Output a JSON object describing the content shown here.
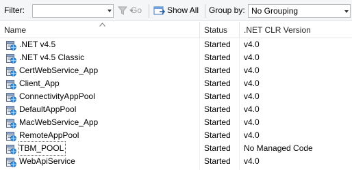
{
  "toolbar": {
    "filter_label": "Filter:",
    "filter_value": "",
    "go_label": "Go",
    "show_all_label": "Show All",
    "group_by_label": "Group by:",
    "group_by_value": "No Grouping"
  },
  "table": {
    "columns": [
      "Name",
      "Status",
      ".NET CLR Version"
    ],
    "rows": [
      {
        "name": ".NET v4.5",
        "status": "Started",
        "clr": "v4.0"
      },
      {
        "name": ".NET v4.5 Classic",
        "status": "Started",
        "clr": "v4.0"
      },
      {
        "name": "CertWebService_App",
        "status": "Started",
        "clr": "v4.0"
      },
      {
        "name": "Client_App",
        "status": "Started",
        "clr": "v4.0"
      },
      {
        "name": "ConnectivityAppPool",
        "status": "Started",
        "clr": "v4.0"
      },
      {
        "name": "DefaultAppPool",
        "status": "Started",
        "clr": "v4.0"
      },
      {
        "name": "MacWebService_App",
        "status": "Started",
        "clr": "v4.0"
      },
      {
        "name": "RemoteAppPool",
        "status": "Started",
        "clr": "v4.0"
      },
      {
        "name": "TBM_POOL",
        "status": "Started",
        "clr": "No Managed Code"
      },
      {
        "name": "WebApiService",
        "status": "Started",
        "clr": "v4.0"
      }
    ],
    "selected_row": "TBM_POOL"
  },
  "icons": {
    "row_icon": "app-pool-icon",
    "go_icon": "filter-funnel-icon",
    "show_all_icon": "show-all-icon"
  },
  "colors": {
    "toolbar_bg": "#f5f6f7",
    "icon_blue": "#2f6db5",
    "icon_globe": "#3a8fd8"
  }
}
